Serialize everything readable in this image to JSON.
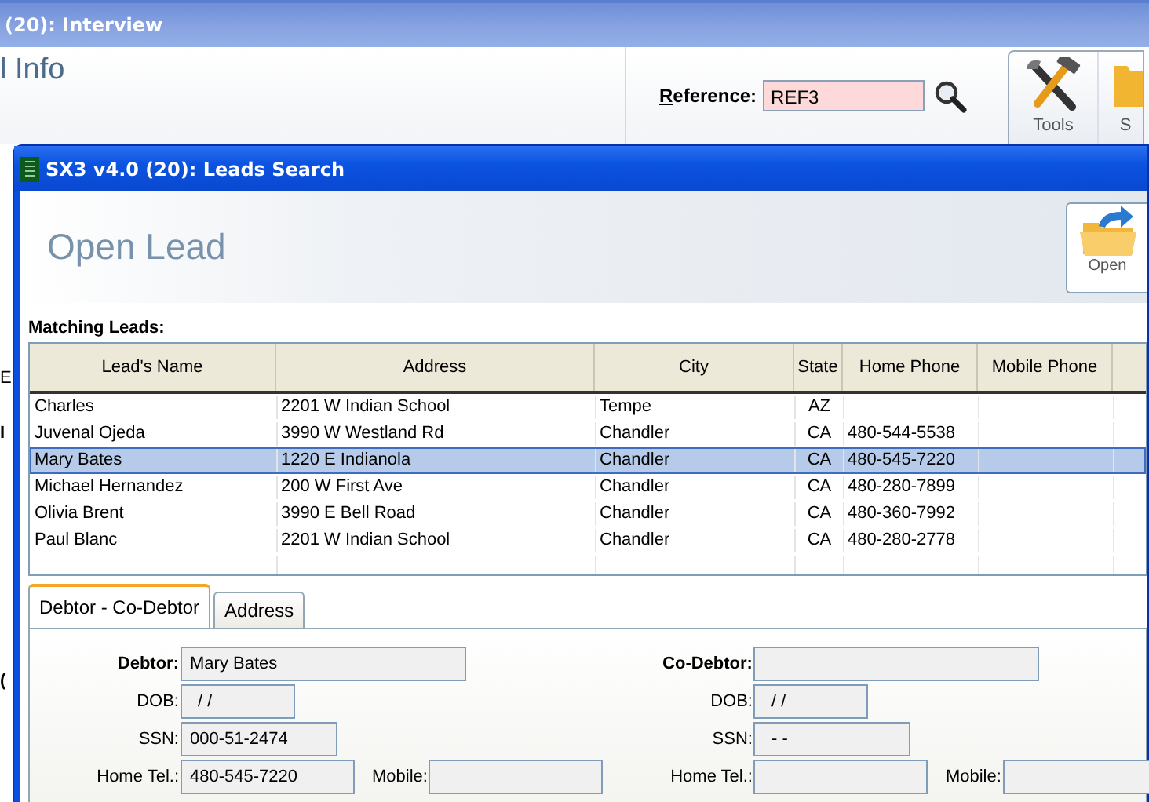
{
  "background_window": {
    "title": "(20): Interview",
    "heading": "l Info",
    "side_fragments": [
      "E",
      "I",
      "("
    ],
    "reference": {
      "label": "Reference:",
      "value": "REF3"
    },
    "toolbar": [
      {
        "label": "Tools",
        "kind": "tools"
      },
      {
        "label": "S",
        "kind": "folder"
      }
    ]
  },
  "leads_window": {
    "title": "SX3 v4.0 (20): Leads Search",
    "heading": "Open Lead",
    "open_button": "Open",
    "matching_label": "Matching Leads:",
    "table": {
      "columns": [
        "Lead's Name",
        "Address",
        "City",
        "State",
        "Home Phone",
        "Mobile Phone"
      ],
      "rows": [
        {
          "cells": [
            "Charles",
            "2201 W Indian School",
            "Tempe",
            "AZ",
            ""
          ],
          "selected": false
        },
        {
          "cells": [
            "Juvenal Ojeda",
            "3990 W Westland Rd",
            "Chandler",
            "CA",
            "480-544-5538"
          ],
          "selected": false
        },
        {
          "cells": [
            "Mary Bates",
            "1220 E Indianola",
            "Chandler",
            "CA",
            "480-545-7220"
          ],
          "selected": true
        },
        {
          "cells": [
            "Michael Hernandez",
            "200 W First Ave",
            "Chandler",
            "CA",
            "480-280-7899"
          ],
          "selected": false
        },
        {
          "cells": [
            "Olivia Brent",
            "3990 E Bell Road",
            "Chandler",
            "CA",
            "480-360-7992"
          ],
          "selected": false
        },
        {
          "cells": [
            "Paul Blanc",
            "2201 W Indian School",
            "Chandler",
            "CA",
            "480-280-2778"
          ],
          "selected": false
        }
      ]
    },
    "tabs": [
      {
        "label": "Debtor - Co-Debtor",
        "selected": true
      },
      {
        "label": "Address",
        "selected": false
      }
    ],
    "parties": [
      {
        "name_label": "Debtor:",
        "name": "Mary Bates",
        "dob_label": "DOB:",
        "dob": "/ /",
        "ssn_label": "SSN:",
        "ssn": "000-51-2474",
        "home_label": "Home Tel.:",
        "home": "480-545-7220",
        "mobile_label": "Mobile:"
      },
      {
        "name_label": "Co-Debtor:",
        "dob_label": "DOB:",
        "dob": "/ /",
        "ssn_label": "SSN:",
        "ssn": "- -",
        "home_label": "Home Tel.:",
        "mobile_label": "Mobile:"
      }
    ]
  }
}
